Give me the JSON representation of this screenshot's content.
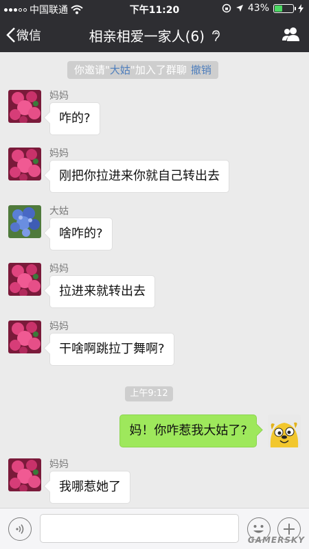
{
  "status_bar": {
    "carrier": "中国联通",
    "time": "下午11:20",
    "battery": "43%",
    "battery_level": 0.43,
    "battery_color": "#4cd964"
  },
  "nav": {
    "back_label": "微信",
    "title": "相亲相爱一家人(6)",
    "back_icon": "chevron-left-icon",
    "mute_icon": "ear-icon",
    "members_icon": "people-icon"
  },
  "notice": {
    "prefix": "你邀请\"",
    "name": "大姑",
    "suffix": "\"加入了群聊",
    "action": "撤销"
  },
  "time_stamp": "上午9:12",
  "messages": [
    {
      "sender": "妈妈",
      "text": "咋的?",
      "avatar": "red-flower-avatar"
    },
    {
      "sender": "妈妈",
      "text": "刚把你拉进来你就自己转出去",
      "avatar": "red-flower-avatar"
    },
    {
      "sender": "大姑",
      "text": "啥咋的?",
      "avatar": "blue-hydrangea-avatar"
    },
    {
      "sender": "妈妈",
      "text": "拉进来就转出去",
      "avatar": "red-flower-avatar"
    },
    {
      "sender": "妈妈",
      "text": "干啥啊跳拉丁舞啊?",
      "avatar": "red-flower-avatar"
    },
    {
      "sender": "妈妈",
      "text": "我哪惹她了",
      "avatar": "red-flower-avatar"
    }
  ],
  "self_message": {
    "text": "妈！你咋惹我大姑了?",
    "avatar": "yellow-dog-avatar"
  },
  "input_bar": {
    "voice_icon": "voice-icon",
    "emoji_icon": "smiley-icon",
    "plus_icon": "plus-icon"
  },
  "watermark": "GAMERSKY",
  "colors": {
    "nav_bg": "#2e2e32",
    "chat_bg": "#ebebeb",
    "self_bubble": "#9ee85c",
    "link": "#4f7fbd"
  }
}
